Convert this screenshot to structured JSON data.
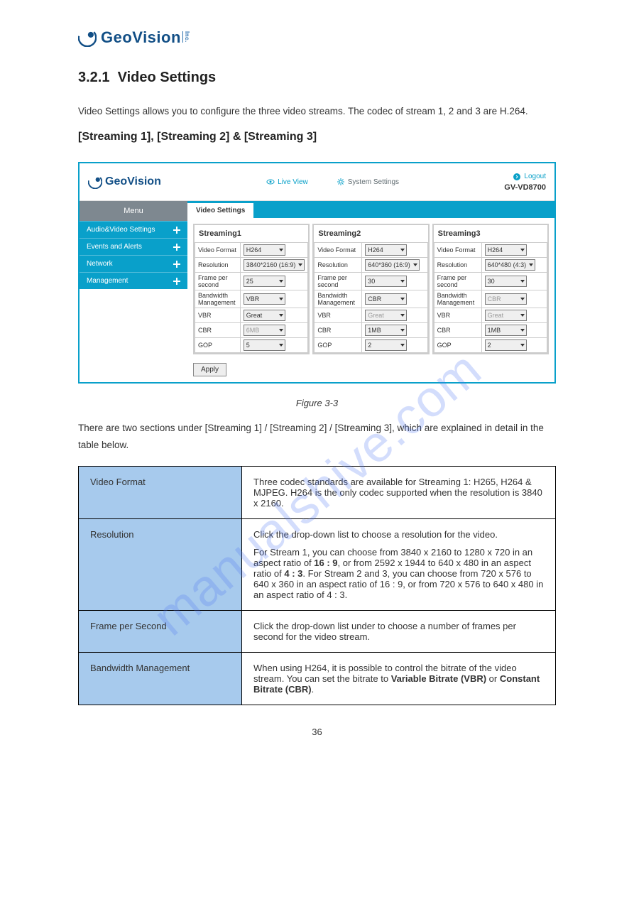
{
  "logo_text": "GeoVision",
  "section": {
    "num": "3.2.1",
    "title": "Video Settings",
    "p1": "Video Settings allows you to configure the three video streams. The codec of stream 1, 2 and 3 are H.264.",
    "subhead": "[Streaming 1], [Streaming 2] & [Streaming 3]"
  },
  "ui": {
    "nav_live": "Live View",
    "nav_sys": "System Settings",
    "logout": "Logout",
    "model": "GV-VD8700",
    "menu": "Menu",
    "sidebar": [
      "Audio&Video Settings",
      "Events and Alerts",
      "Network",
      "Management"
    ],
    "tab": "Video Settings",
    "streams": [
      {
        "title": "Streaming1",
        "rows": [
          {
            "label": "Video Format",
            "value": "H264",
            "disabled": false
          },
          {
            "label": "Resolution",
            "value": "3840*2160 (16:9)",
            "disabled": false
          },
          {
            "label": "Frame per second",
            "value": "25",
            "disabled": false
          },
          {
            "label": "Bandwidth Management",
            "value": "VBR",
            "disabled": false
          },
          {
            "label": "VBR",
            "value": "Great",
            "disabled": false
          },
          {
            "label": "CBR",
            "value": "6MB",
            "disabled": true
          },
          {
            "label": "GOP",
            "value": "5",
            "disabled": false
          }
        ]
      },
      {
        "title": "Streaming2",
        "rows": [
          {
            "label": "Video Format",
            "value": "H264",
            "disabled": false
          },
          {
            "label": "Resolution",
            "value": "640*360 (16:9)",
            "disabled": false
          },
          {
            "label": "Frame per second",
            "value": "30",
            "disabled": false
          },
          {
            "label": "Bandwidth Management",
            "value": "CBR",
            "disabled": false
          },
          {
            "label": "VBR",
            "value": "Great",
            "disabled": true
          },
          {
            "label": "CBR",
            "value": "1MB",
            "disabled": false
          },
          {
            "label": "GOP",
            "value": "2",
            "disabled": false
          }
        ]
      },
      {
        "title": "Streaming3",
        "rows": [
          {
            "label": "Video Format",
            "value": "H264",
            "disabled": false
          },
          {
            "label": "Resolution",
            "value": "640*480 (4:3)",
            "disabled": false
          },
          {
            "label": "Frame per second",
            "value": "30",
            "disabled": false
          },
          {
            "label": "Bandwidth Management",
            "value": "CBR",
            "disabled": true
          },
          {
            "label": "VBR",
            "value": "Great",
            "disabled": true
          },
          {
            "label": "CBR",
            "value": "1MB",
            "disabled": false
          },
          {
            "label": "GOP",
            "value": "2",
            "disabled": false
          }
        ]
      }
    ],
    "apply": "Apply"
  },
  "caption": "Figure 3-3",
  "post_caption": "There are two sections under [Streaming 1] / [Streaming 2] / [Streaming 3], which are explained in detail in the table below.",
  "desc_table": {
    "rows": [
      {
        "name": "Video Format",
        "text": "Three codec standards are available for Streaming 1: H265, H264 & MJPEG. H264 is the only codec supported when the resolution is 3840 x 2160."
      },
      {
        "name": "Resolution",
        "text_p1": "Click the drop-down list to choose a resolution for the video.",
        "text_p2_pre": "For Stream 1, you can choose from 3840 x 2160 to 1280 x 720 in an aspect ratio of ",
        "text_p2_b1": "16 : 9",
        "text_p2_mid": ", or from 2592 x 1944 to 640 x 480 in an aspect ratio of ",
        "text_p2_b2": "4 : 3",
        "text_p2_post": ". For Stream 2 and 3, you can choose from 720 x 576 to 640 x 360 in an aspect ratio of 16 : 9, or from 720 x 576 to 640 x 480 in an aspect ratio of 4 : 3."
      },
      {
        "name": "Frame per Second",
        "text": "Click the drop-down list under to choose a number of frames per second for the video stream."
      },
      {
        "name": "Bandwidth Management",
        "text_pre": "When using H264, it is possible to control the bitrate of the video stream. You can set the bitrate to ",
        "text_b1": "Variable Bitrate (VBR)",
        "text_mid": " or ",
        "text_b2": "Constant Bitrate (CBR)",
        "text_post": "."
      }
    ]
  },
  "page_num": "36"
}
